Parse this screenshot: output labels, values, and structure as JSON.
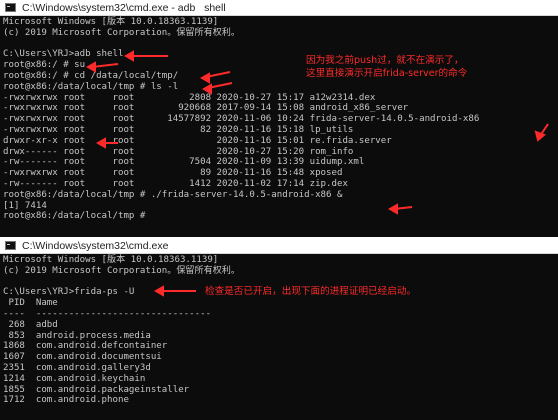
{
  "windows": [
    {
      "title": "C:\\Windows\\system32\\cmd.exe - adb   shell",
      "lines": [
        "Microsoft Windows [版本 10.0.18363.1139]",
        "(c) 2019 Microsoft Corporation。保留所有权利。",
        "",
        "C:\\Users\\YRJ>adb shell",
        "root@x86:/ # su",
        "root@x86:/ # cd /data/local/tmp/",
        "root@x86:/data/local/tmp # ls -l",
        "-rwxrwxrwx root     root          2808 2020-10-27 15:17 a12w2314.dex",
        "-rwxrwxrwx root     root        920668 2017-09-14 15:08 android_x86_server",
        "-rwxrwxrwx root     root      14577892 2020-11-06 10:24 frida-server-14.0.5-android-x86",
        "-rwxrwxrwx root     root            82 2020-11-16 15:18 lp_utils",
        "drwxr-xr-x root     root               2020-11-16 15:01 re.frida.server",
        "drwx------ root     root               2020-10-27 15:20 rom_info",
        "-rw------- root     root          7504 2020-11-09 13:39 uidump.xml",
        "-rwxrwxrwx root     root            89 2020-11-16 15:48 xposed",
        "-rw------- root     root          1412 2020-11-02 17:14 zip.dex",
        "root@x86:/data/local/tmp # ./frida-server-14.0.5-android-x86 &",
        "[1] 7414",
        "root@x86:/data/local/tmp #"
      ],
      "annotation": "因为我之前push过，就不在演示了，\n这里直接演示开启frida-server的命令"
    },
    {
      "title": "C:\\Windows\\system32\\cmd.exe",
      "lines": [
        "Microsoft Windows [版本 10.0.18363.1139]",
        "(c) 2019 Microsoft Corporation。保留所有权利。",
        "",
        "C:\\Users\\YRJ>frida-ps -U",
        " PID  Name",
        "----  --------------------------------",
        " 268  adbd",
        " 853  android.process.media",
        "1868  com.android.defcontainer",
        "1607  com.android.documentsui",
        "2351  com.android.gallery3d",
        "1214  com.android.keychain",
        "1855  com.android.packageinstaller",
        "1712  com.android.phone"
      ],
      "annotation": "检查是否已开启，出现下面的进程证明已经启动。"
    }
  ],
  "colors": {
    "console_bg": "#0c0c0c",
    "console_text": "#c6c6c6",
    "annotation": "#ff2a2a"
  },
  "icons": [
    "cmd-window-icon"
  ]
}
